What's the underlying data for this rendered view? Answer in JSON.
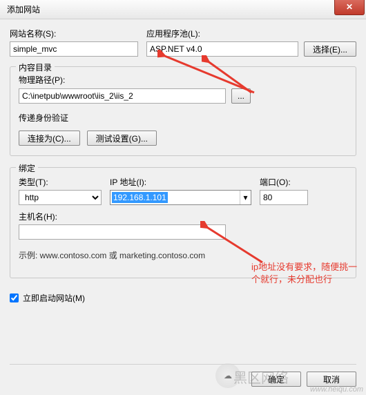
{
  "title": "添加网站",
  "close_glyph": "✕",
  "site_name": {
    "label": "网站名称(S):",
    "value": "simple_mvc"
  },
  "app_pool": {
    "label": "应用程序池(L):",
    "value": "ASP.NET v4.0",
    "select_btn": "选择(E)..."
  },
  "content_dir": {
    "group_title": "内容目录",
    "physical_path_label": "物理路径(P):",
    "physical_path_value": "C:\\inetpub\\wwwroot\\iis_2\\iis_2",
    "browse_glyph": "...",
    "auth_label": "传递身份验证",
    "connect_as_btn": "连接为(C)...",
    "test_settings_btn": "测试设置(G)..."
  },
  "binding": {
    "group_title": "绑定",
    "type_label": "类型(T):",
    "type_value": "http",
    "ip_label": "IP 地址(I):",
    "ip_value": "192.168.1.101",
    "port_label": "端口(O):",
    "port_value": "80",
    "hostname_label": "主机名(H):",
    "hostname_value": "",
    "example_text": "示例: www.contoso.com 或 marketing.contoso.com"
  },
  "annotation": "ip地址没有要求，随便挑一个就行，未分配也行",
  "start_site_label": "立即启动网站(M)",
  "start_site_checked": true,
  "footer": {
    "ok": "确定",
    "cancel": "取消"
  },
  "watermark": {
    "text": "www.heiqu.com",
    "logo": "黑区网络"
  }
}
